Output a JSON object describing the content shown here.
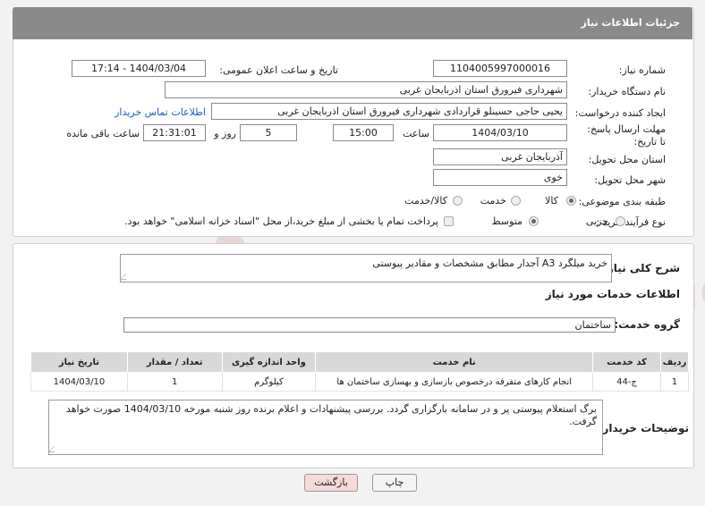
{
  "header": {
    "title": "جزئیات اطلاعات نیاز"
  },
  "fields": {
    "need_number_label": "شماره نیاز:",
    "need_number": "1104005997000016",
    "announce_label": "تاریخ و ساعت اعلان عمومی:",
    "announce_value": "1404/03/04 - 17:14",
    "buyer_org_label": "نام دستگاه خریدار:",
    "buyer_org": "شهرداری فیرورق استان اذربایجان غربی",
    "creator_label": "ایجاد کننده درخواست:",
    "creator": "یحیی حاجی حسینلو قراردادی شهرداری فیرورق استان اذربایجان غربی",
    "contact_link": "اطلاعات تماس خریدار",
    "deadline_label": "مهلت ارسال پاسخ: تا تاریخ:",
    "deadline_date": "1404/03/10",
    "time_label": "ساعت",
    "deadline_time": "15:00",
    "days_value": "5",
    "days_label": "روز و",
    "remaining_time": "21:31:01",
    "remaining_label": "ساعت باقی مانده",
    "province_label": "استان محل تحویل:",
    "province": "آذربایجان غربی",
    "city_label": "شهر محل تحویل:",
    "city": "خوی",
    "category_label": "طبقه بندی موضوعی:",
    "category_options": [
      "کالا",
      "خدمت",
      "کالا/خدمت"
    ],
    "process_label": "نوع فرآیند خرید :",
    "process_options": [
      "جزیی",
      "متوسط"
    ],
    "payment_note": "پرداخت تمام یا بخشی از مبلغ خرید،از محل \"اسناد خزانه اسلامی\" خواهد بود."
  },
  "summary": {
    "label": "شرح کلی نیاز:",
    "text": "خرید میلگرد A3 آجدار مطابق مشخصات و مقادیر پیوستی"
  },
  "services": {
    "section_title": "اطلاعات خدمات مورد نیاز",
    "group_label": "گروه خدمت:",
    "group_value": "ساختمان",
    "columns": [
      "ردیف",
      "کد خدمت",
      "نام خدمت",
      "واحد اندازه گیری",
      "تعداد / مقدار",
      "تاریخ نیاز"
    ],
    "rows": [
      [
        "1",
        "ج-44",
        "انجام کارهای متفرقه درخصوص بازسازی و بهسازی ساختمان ها",
        "کیلوگرم",
        "1",
        "1404/03/10"
      ]
    ]
  },
  "notes": {
    "label": "توضیحات خریدار:",
    "text": "برگ استعلام پیوستی پر و در سامانه بارگزاری گردد. بررسی پیشنهادات و اعلام برنده روز شنبه مورخه 1404/03/10 صورت خواهد گرفت."
  },
  "buttons": {
    "print": "چاپ",
    "back": "بازگشت"
  },
  "watermark": {
    "text": "AriaTender.neT"
  },
  "colors": {
    "header": "#8a8a8a",
    "link": "#1a5fb4",
    "back_button": "#f7d9d9",
    "watermark": "#c0392b"
  }
}
